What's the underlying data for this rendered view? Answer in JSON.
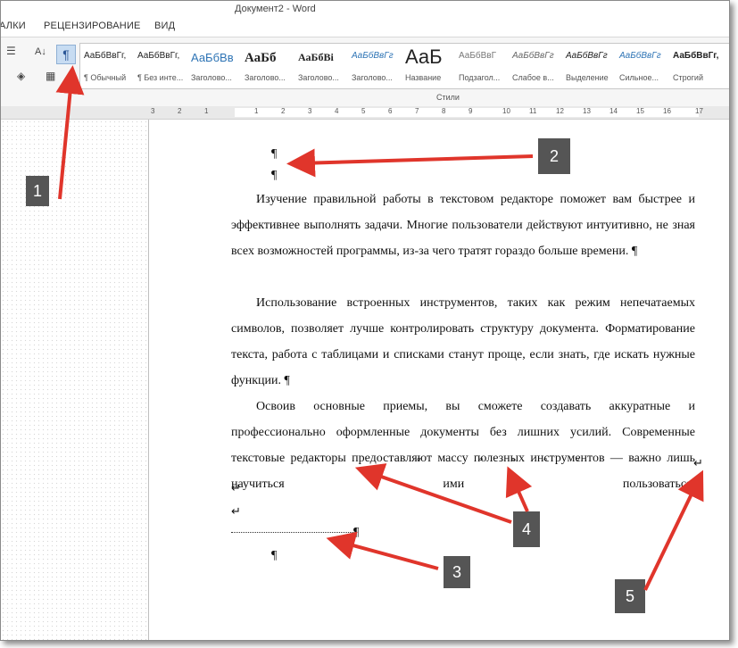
{
  "window": {
    "title": "Документ2 - Word"
  },
  "ribbon_tabs": [
    "АЛКИ",
    "РЕЦЕНЗИРОВАНИЕ",
    "ВИД"
  ],
  "ribbon": {
    "sort_icon": "А↓",
    "pilcrow_button": "¶",
    "group_label": "Стили",
    "styles": [
      {
        "preview": "АаБбВвГг,",
        "label": "¶ Обычный"
      },
      {
        "preview": "АаБбВвГг,",
        "label": "¶ Без инте..."
      },
      {
        "preview": "АаБбВв",
        "label": "Заголово..."
      },
      {
        "preview": "АаБб",
        "label": "Заголово..."
      },
      {
        "preview": "АаБбВі",
        "label": "Заголово..."
      },
      {
        "preview": "АаБбВвГг",
        "label": "Заголово..."
      },
      {
        "preview": "АаБ",
        "label": "Название"
      },
      {
        "preview": "АаБбВвГ",
        "label": "Подзагол..."
      },
      {
        "preview": "АаБбВвГг",
        "label": "Слабое в..."
      },
      {
        "preview": "АаБбВвГг",
        "label": "Выделение"
      },
      {
        "preview": "АаБбВвГг",
        "label": "Сильное..."
      },
      {
        "preview": "АаБбВвГг,",
        "label": "Строгий"
      }
    ]
  },
  "ruler": {
    "numbers": [
      "3",
      "2",
      "1",
      "1",
      "2",
      "3",
      "4",
      "5",
      "6",
      "7",
      "8",
      "9",
      "10",
      "11",
      "12",
      "13",
      "14",
      "15",
      "16",
      "17"
    ]
  },
  "document": {
    "empty_marks": [
      "¶",
      "¶"
    ],
    "paragraphs": [
      "Изучение правильной работы в текстовом редакторе поможет вам быстрее и эффективнее выполнять задачи. Многие пользователи действуют интуитивно, не зная всех возможностей программы, из-за чего тратят гораздо больше времени. ¶",
      "Использование встроенных инструментов, таких как режим непечатаемых символов, позволяет лучше контролировать структуру документа. Форматирование текста, работа с таблицами и списками станут проще, если знать, где искать нужные функции. ¶",
      "Освоив основные приемы, вы сможете создавать аккуратные и профессионально оформленные документы без лишних усилий. Современные текстовые редакторы предоставляют массу полезных инструментов — важно лишь научиться ими пользоваться."
    ],
    "line_break": "↵",
    "line_breaks_extra": [
      "↵",
      "↵"
    ],
    "after_dotline_mark": "¶",
    "final_mark": "¶",
    "nbsp": "°"
  },
  "callouts": [
    "1",
    "2",
    "3",
    "4",
    "5"
  ],
  "colors": {
    "arrow": "#e0352b",
    "callout_bg": "#555555",
    "ribbon_bg": "#f6f6f6"
  }
}
